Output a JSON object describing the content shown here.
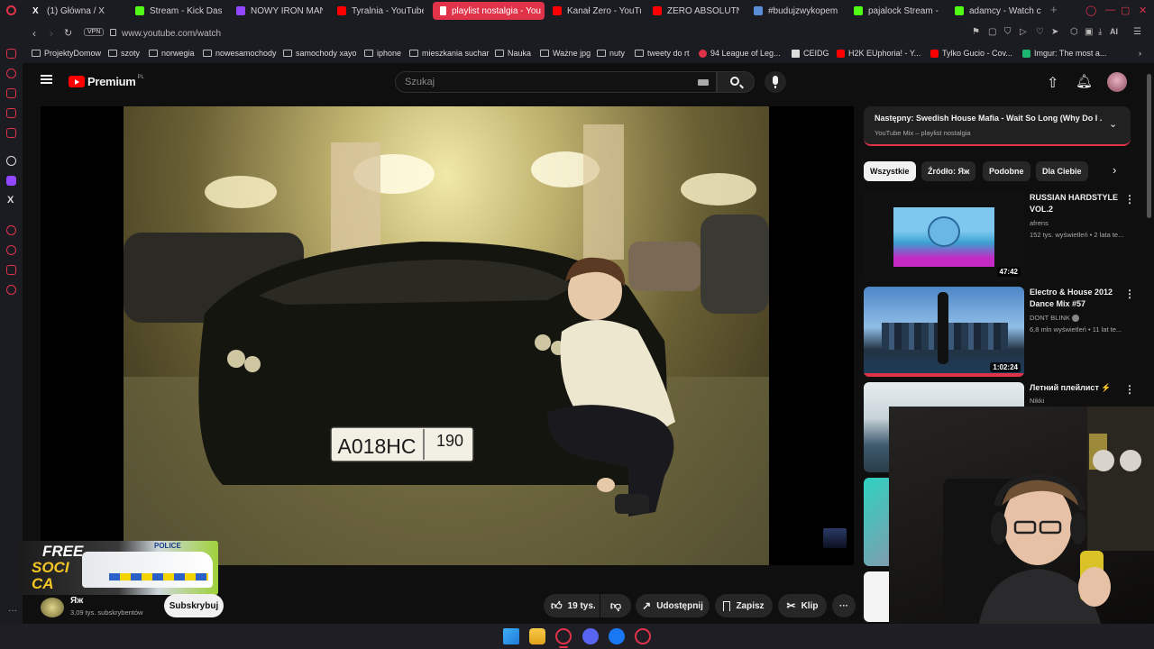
{
  "browser": {
    "tabs": [
      {
        "label": "(1) Główna / X",
        "color": "#ffffff"
      },
      {
        "label": "Stream - Kick Dashbo",
        "color": "#53fc18"
      },
      {
        "label": "NOWY IRON MAN LE",
        "color": "#9146ff"
      },
      {
        "label": "Tyralnia - YouTube",
        "color": "#ff0000"
      },
      {
        "label": "playlist nostalgia - You",
        "color": "#ffffff"
      },
      {
        "label": "Kanał Zero - YouTube",
        "color": "#ff0000"
      },
      {
        "label": "ZERO ABSOLUTNE",
        "color": "#ff0000"
      },
      {
        "label": "#budujzwykopem :: W",
        "color": "#5a8fd8"
      },
      {
        "label": "pajalock Stream - Wat",
        "color": "#53fc18"
      },
      {
        "label": "adamcy - Watch clips",
        "color": "#53fc18"
      }
    ],
    "new_tab": "+",
    "vpn": "VPN",
    "url": "www.youtube.com/watch",
    "bookmarks": [
      "ProjektyDomow",
      "szoty",
      "norwegia",
      "nowesamochody",
      "samochody xayo",
      "iphone",
      "mieszkania suchar",
      "Nauka",
      "Ważne jpg",
      "nuty",
      "tweety do rt",
      "94 League of Leg...",
      "CEIDG",
      "H2K EUphoria! - Y...",
      "Tylko Gucio - Cov...",
      "Imgur: The most a..."
    ]
  },
  "youtube": {
    "logo_text": "Premium",
    "logo_region": "PL",
    "search_placeholder": "Szukaj",
    "plate_left": "А018НС",
    "plate_right": "190",
    "channel_name": "Яж",
    "subscribers": "3,09 tys. subskrybentów",
    "subscribe_label": "Subskrybuj",
    "likes": "19 tys.",
    "share_label": "Udostępnij",
    "save_label": "Zapisz",
    "clip_label": "Klip",
    "overlay_text_1": "FREE",
    "overlay_text_2": "SOCI",
    "overlay_text_3": "CA",
    "overlay_police": "POLICE",
    "upnext": {
      "prefix": "Następny:",
      "title": "Swedish House Mafia - Wait So Long (Why Do I ...",
      "subtitle": "YouTube Mix – playlist nostalgia"
    },
    "chips": [
      "Wszystkie",
      "Źródło: Яж",
      "Podobne",
      "Dla Ciebie"
    ],
    "related": [
      {
        "title": "RUSSIAN HARDSTYLE VOL.2",
        "channel": "afrens",
        "meta": "152 tys. wyświetleń • 2 lata te...",
        "duration": "47:42"
      },
      {
        "title": "Electro & House 2012 Dance Mix #57",
        "channel": "DONT BLINK",
        "meta": "6,8 mln wyświetleń • 11 lat te...",
        "duration": "1:02:24"
      },
      {
        "title": "Летний плейлист ⚡",
        "channel": "Nikki",
        "meta": "",
        "duration": ""
      }
    ]
  },
  "colors": {
    "accent": "#e0334a",
    "yt_red": "#ff0000",
    "bg": "#0f0f0f",
    "chrome": "#1b1b22"
  }
}
